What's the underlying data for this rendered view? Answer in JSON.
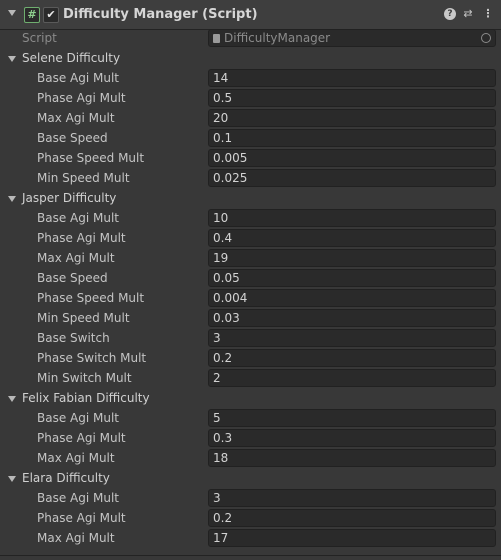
{
  "header": {
    "title": "Difficulty Manager (Script)",
    "script_icon": "#",
    "enabled_mark": "✔",
    "icons": [
      "help-icon",
      "presets-icon",
      "more-icon"
    ]
  },
  "script_row": {
    "label": "Script",
    "value": "DifficultyManager"
  },
  "groups": [
    {
      "title": "Selene Difficulty",
      "fields": [
        {
          "label": "Base Agi Mult",
          "value": "14"
        },
        {
          "label": "Phase Agi Mult",
          "value": "0.5"
        },
        {
          "label": "Max Agi Mult",
          "value": "20"
        },
        {
          "label": "Base Speed",
          "value": "0.1"
        },
        {
          "label": "Phase Speed Mult",
          "value": "0.005"
        },
        {
          "label": "Min Speed Mult",
          "value": "0.025"
        }
      ]
    },
    {
      "title": "Jasper Difficulty",
      "fields": [
        {
          "label": "Base Agi Mult",
          "value": "10"
        },
        {
          "label": "Phase Agi Mult",
          "value": "0.4"
        },
        {
          "label": "Max Agi Mult",
          "value": "19"
        },
        {
          "label": "Base Speed",
          "value": "0.05"
        },
        {
          "label": "Phase Speed Mult",
          "value": "0.004"
        },
        {
          "label": "Min Speed Mult",
          "value": "0.03"
        },
        {
          "label": "Base Switch",
          "value": "3"
        },
        {
          "label": "Phase Switch Mult",
          "value": "0.2"
        },
        {
          "label": "Min Switch Mult",
          "value": "2"
        }
      ]
    },
    {
      "title": "Felix Fabian Difficulty",
      "fields": [
        {
          "label": "Base Agi Mult",
          "value": "5"
        },
        {
          "label": "Phase Agi Mult",
          "value": "0.3"
        },
        {
          "label": "Max Agi Mult",
          "value": "18"
        }
      ]
    },
    {
      "title": "Elara Difficulty",
      "fields": [
        {
          "label": "Base Agi Mult",
          "value": "3"
        },
        {
          "label": "Phase Agi Mult",
          "value": "0.2"
        },
        {
          "label": "Max Agi Mult",
          "value": "17"
        }
      ]
    }
  ]
}
